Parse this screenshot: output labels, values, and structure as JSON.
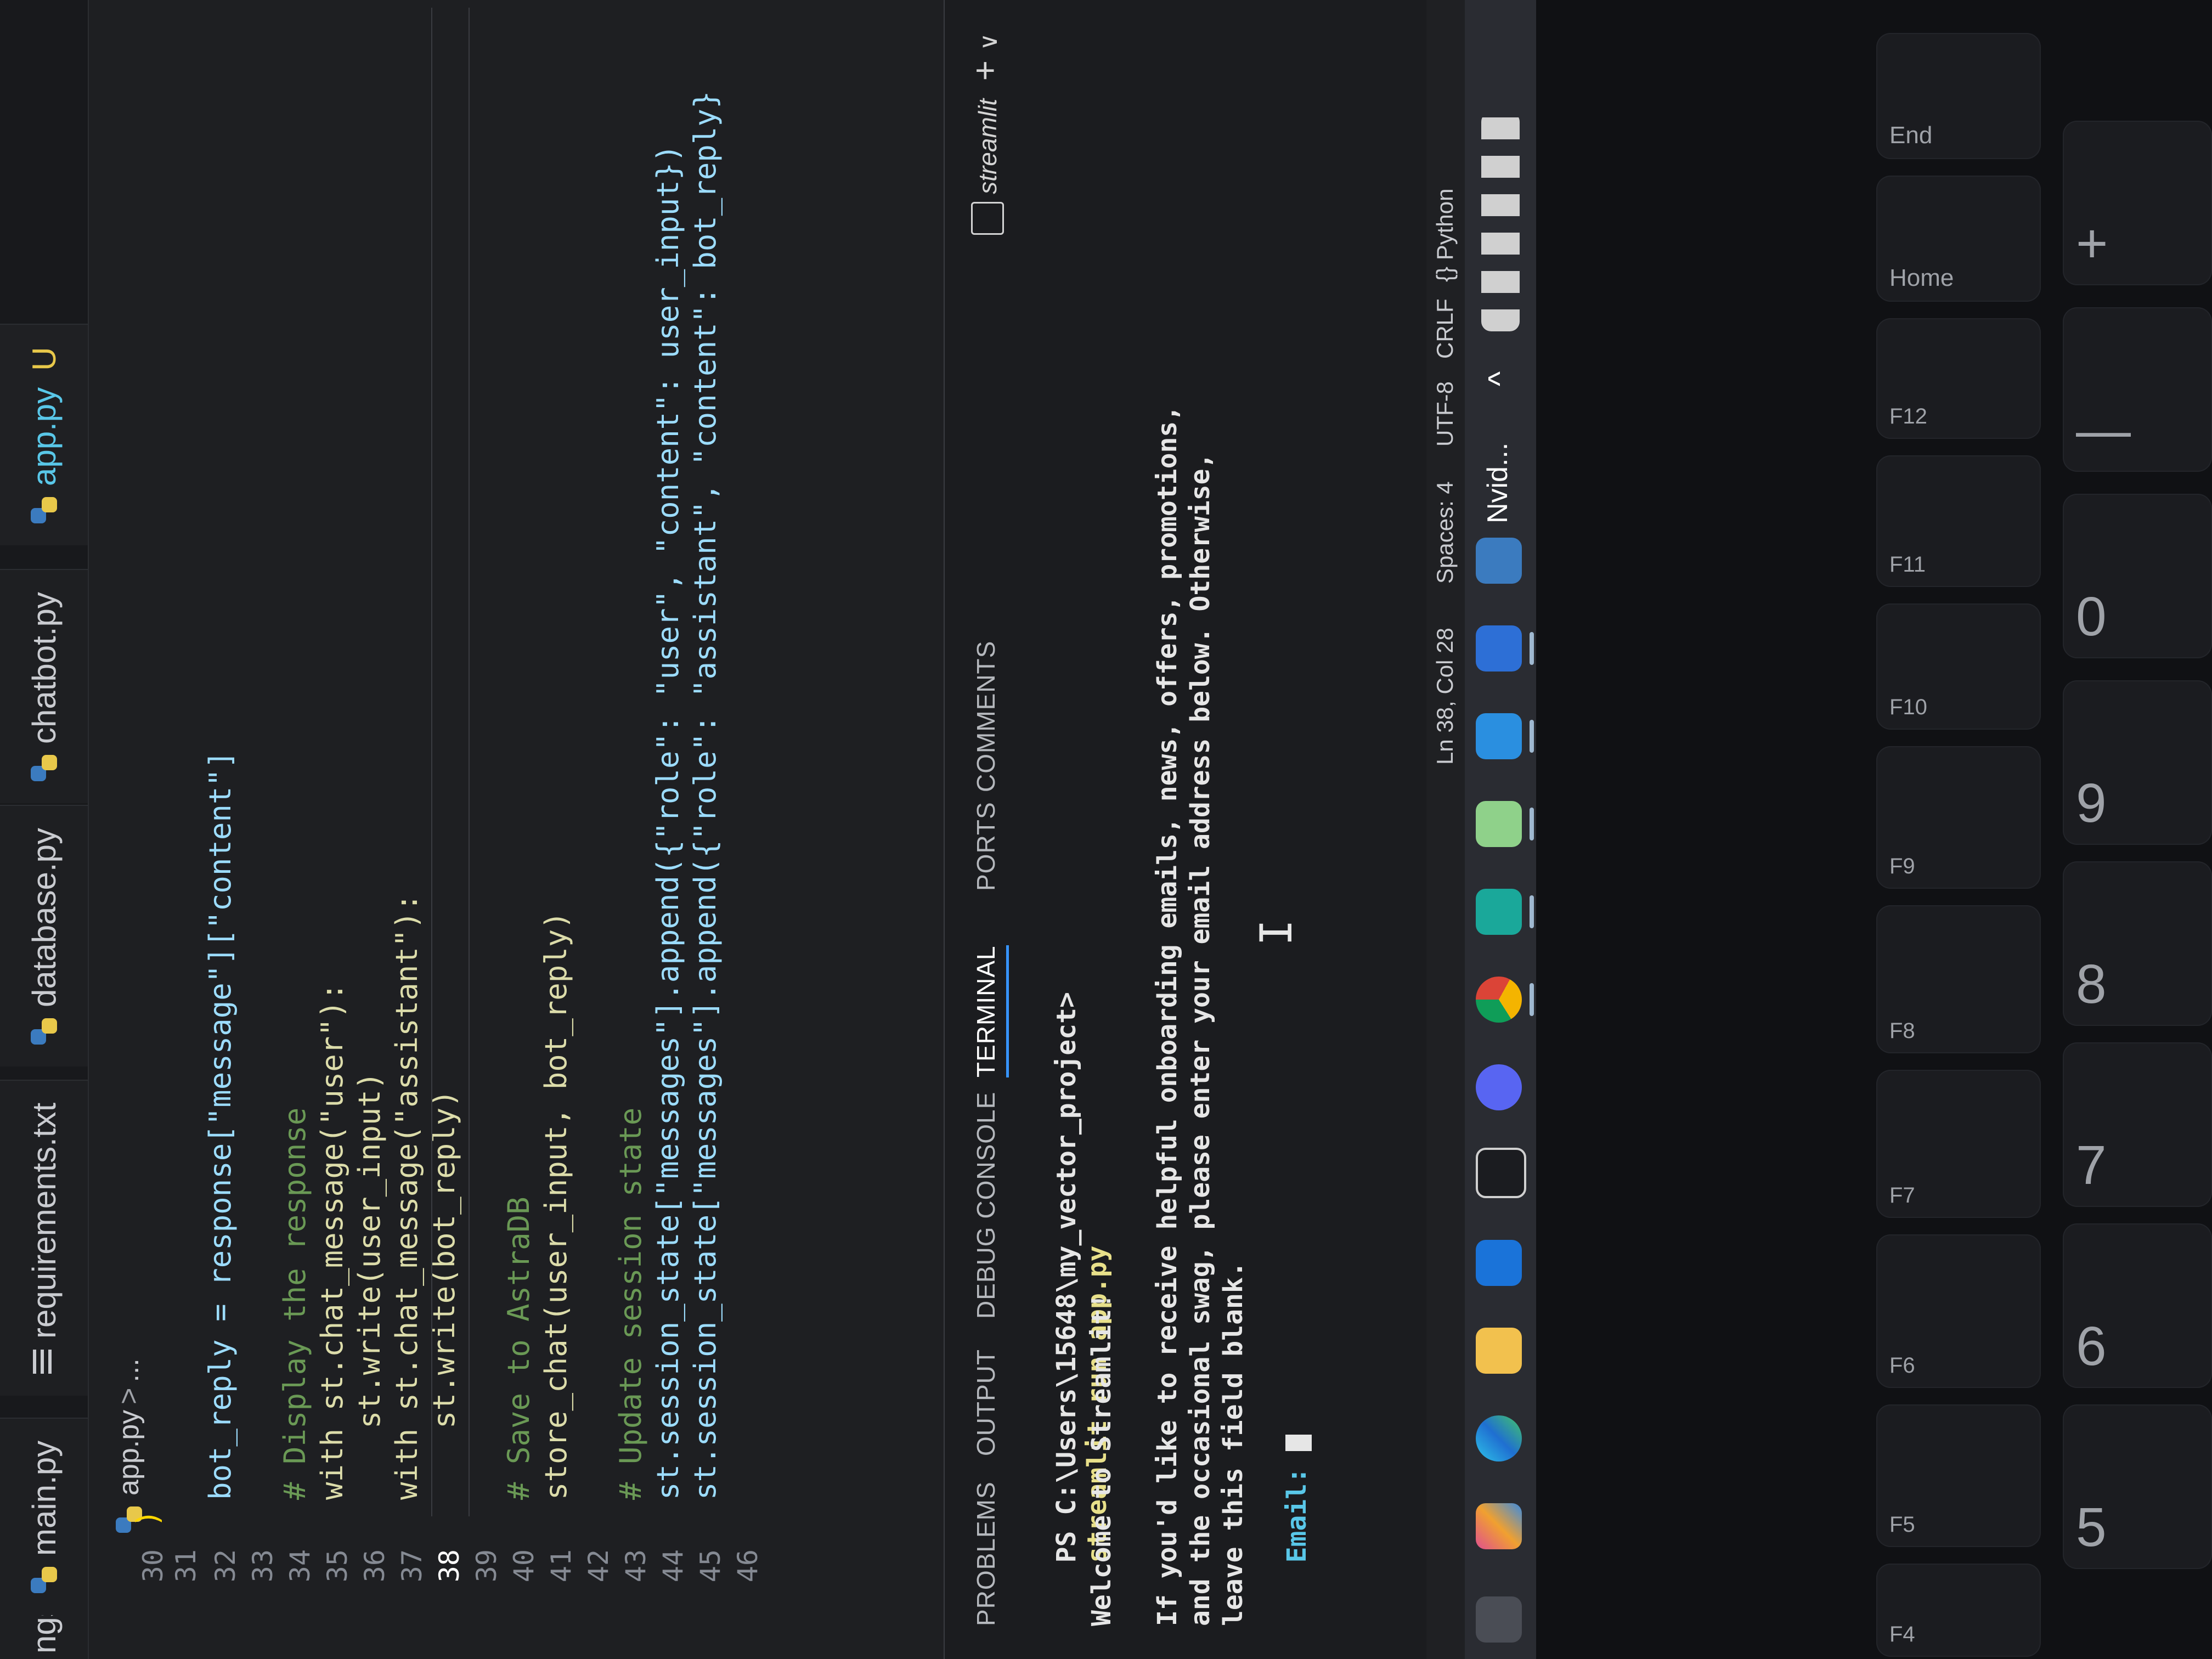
{
  "tabs": [
    {
      "label": "ngs",
      "type": "partial"
    },
    {
      "label": "main.py",
      "icon": "python-icon"
    },
    {
      "label": "requirements.txt",
      "icon": "text-file-icon"
    },
    {
      "label": "database.py",
      "icon": "python-icon"
    },
    {
      "label": "chatbot.py",
      "icon": "python-icon"
    },
    {
      "label": "app.py",
      "icon": "python-icon",
      "active": true
    },
    {
      "label": "U",
      "type": "git-status"
    }
  ],
  "breadcrumb": {
    "file": "app.py",
    "separator": ">",
    "more": "..."
  },
  "editor": {
    "lines": [
      {
        "num": "30",
        "text": ")"
      },
      {
        "num": "31",
        "text": ""
      },
      {
        "num": "32",
        "text": "bot_reply = response[\"message\"][\"content\"]"
      },
      {
        "num": "33",
        "text": ""
      },
      {
        "num": "34",
        "text": "# Display the response"
      },
      {
        "num": "35",
        "text": "with st.chat_message(\"user\"):"
      },
      {
        "num": "36",
        "text": "    st.write(user_input)"
      },
      {
        "num": "37",
        "text": "with st.chat_message(\"assistant\"):"
      },
      {
        "num": "38",
        "text": "    st.write(bot_reply)"
      },
      {
        "num": "39",
        "text": ""
      },
      {
        "num": "40",
        "text": "# Save to AstraDB"
      },
      {
        "num": "41",
        "text": "store_chat(user_input, bot_reply)"
      },
      {
        "num": "42",
        "text": ""
      },
      {
        "num": "43",
        "text": "# Update session state"
      },
      {
        "num": "44",
        "text": "st.session_state[\"messages\"].append({\"role\": \"user\", \"content\": user_input})"
      },
      {
        "num": "45",
        "text": "st.session_state[\"messages\"].append({\"role\": \"assistant\", \"content\": bot_reply}"
      },
      {
        "num": "46",
        "text": ""
      }
    ]
  },
  "panel": {
    "tabs": [
      "PROBLEMS",
      "OUTPUT",
      "DEBUG CONSOLE",
      "TERMINAL",
      "PORTS",
      "COMMENTS"
    ],
    "active_tab": "TERMINAL",
    "terminal_name": "streamlit",
    "add_label": "+",
    "chevron": "∨",
    "prompt": "PS C:\\Users\\15648\\my_vector_project>",
    "command": "streamlit run app.py",
    "output": [
      "Welcome to Streamlit!",
      "",
      "If you'd like to receive helpful onboarding emails, news, offers, promotions,",
      "and the occasional swag, please enter your email address below. Otherwise,",
      "leave this field blank."
    ],
    "email_label": "Email:"
  },
  "statusbar": {
    "position": "Ln 38, Col 28",
    "spaces": "Spaces: 4",
    "encoding": "UTF-8",
    "eol": "CRLF",
    "language_icon": "{}",
    "language": "Python"
  },
  "taskbar": {
    "apps": [
      "task-view-icon",
      "copilot-icon",
      "edge-icon",
      "file-explorer-icon",
      "outlook-icon",
      "terminal-icon",
      "discord-icon",
      "chrome-icon",
      "app-icon",
      "notepad-icon",
      "vscode-icon",
      "powershell-icon",
      "nvidia-widget-icon"
    ],
    "nvidia_label": "Nvid...",
    "tray_chevron": "^"
  },
  "keyboard": {
    "fn_row": [
      "F4",
      "F5",
      "F6",
      "F7",
      "F8",
      "F9",
      "F10",
      "F11",
      "F12",
      "Home",
      "End"
    ],
    "num_row": [
      "5",
      "6",
      "7",
      "8",
      "9",
      "0",
      "—",
      "+"
    ],
    "num_shift": [
      "%",
      "^",
      "&",
      "*",
      "(",
      ")",
      "_",
      "="
    ]
  }
}
